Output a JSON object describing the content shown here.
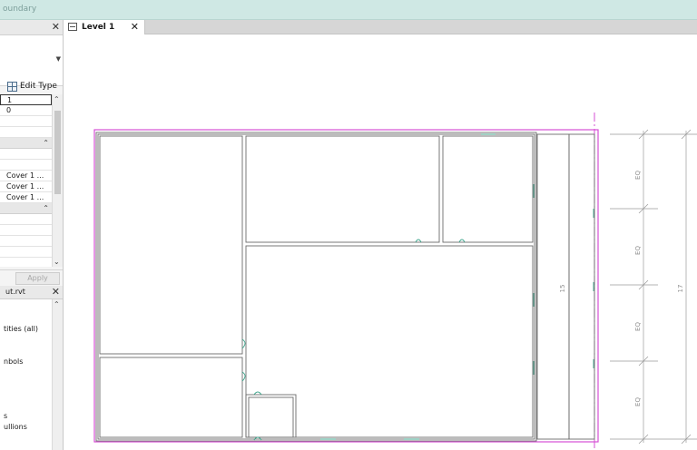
{
  "titlebar": {
    "text": "oundary"
  },
  "properties": {
    "close": "✕",
    "edit_type": "Edit Type",
    "first_value": "1",
    "second_value": "0",
    "rows": [
      "Cover 1 ...",
      "Cover 1 ...",
      "Cover 1 ..."
    ],
    "apply": "Apply"
  },
  "project_browser": {
    "title": "ut.rvt",
    "close": "✕",
    "items": [
      "tities (all)",
      "nbols",
      "s",
      "ullions"
    ]
  },
  "view_tab": {
    "label": "Level 1",
    "close": "✕"
  },
  "dimensions": {
    "eq_labels": [
      "EQ",
      "EQ",
      "EQ",
      "EQ"
    ],
    "inner": "15",
    "overall": "17"
  },
  "colors": {
    "boundary": "#d54fd4",
    "walls": "#6b6b6b",
    "openings": "#3fa58c"
  }
}
